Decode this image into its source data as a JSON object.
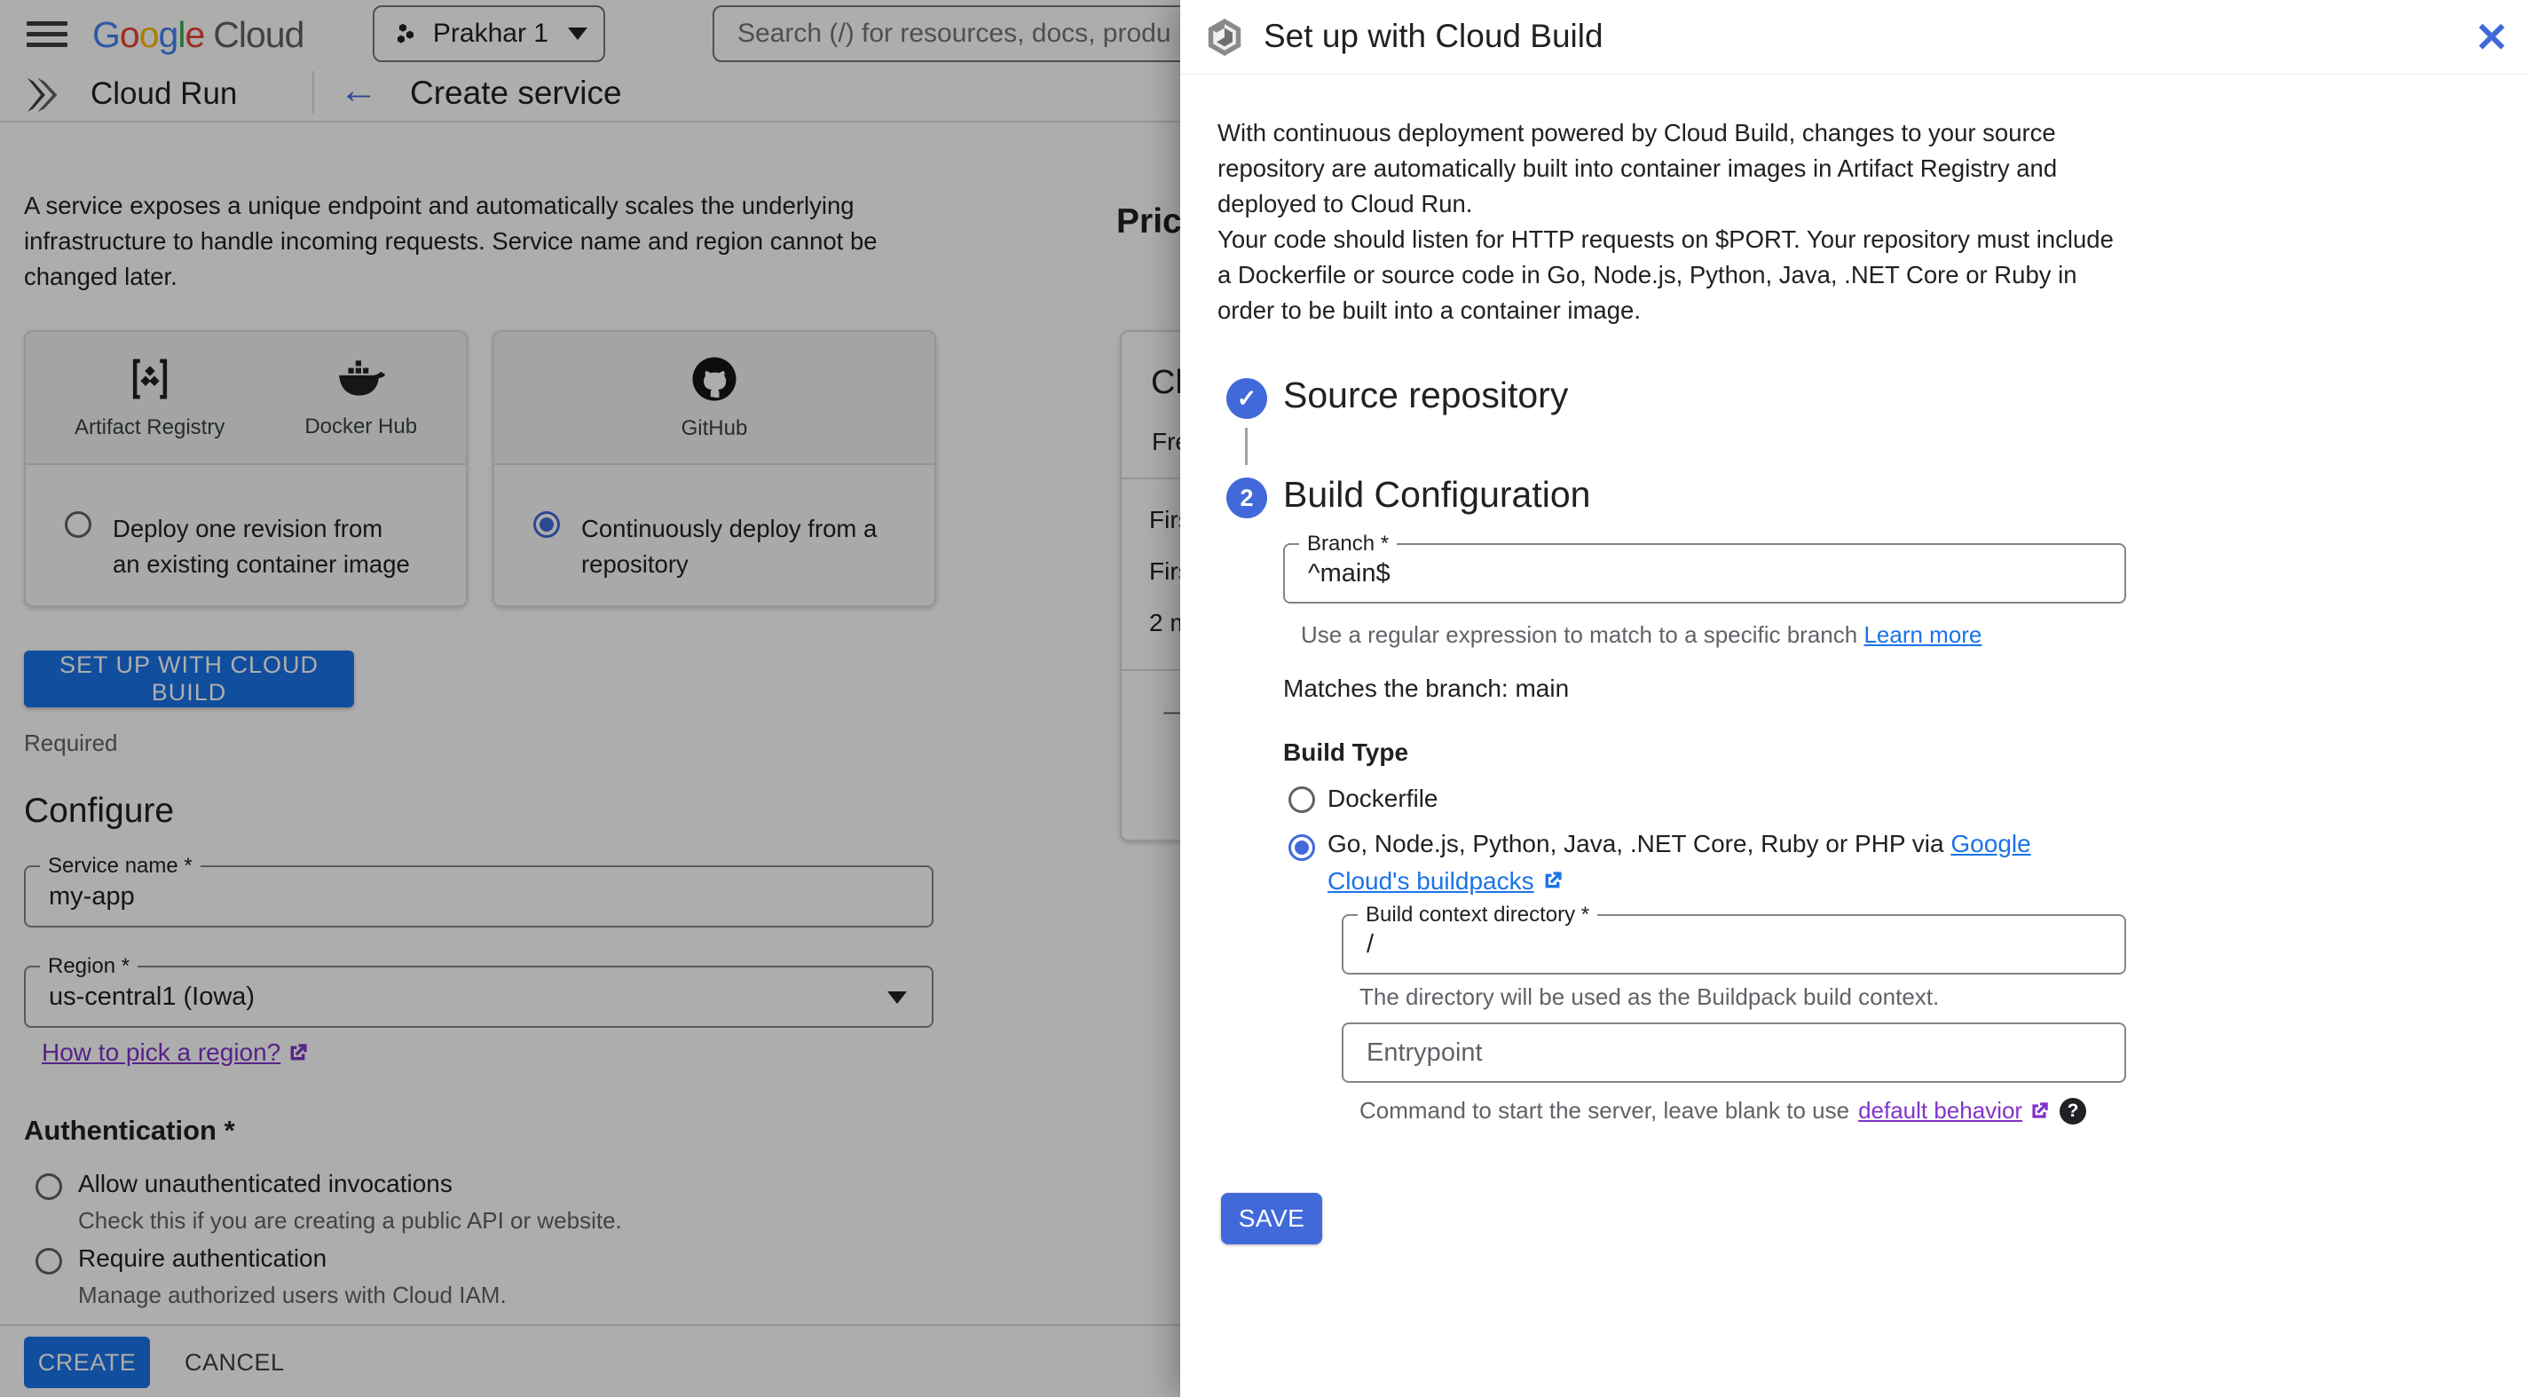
{
  "icons": {
    "back_arrow": "←",
    "close": "✕",
    "check": "✓",
    "step2": "2",
    "arrow_right": "→",
    "help": "?"
  },
  "topbar": {
    "logo_letters": [
      "G",
      "o",
      "o",
      "g",
      "l",
      "e"
    ],
    "logo_cloud": "Cloud",
    "project_selector": "Prakhar 1",
    "search_placeholder": "Search (/) for resources, docs, produ"
  },
  "subheader": {
    "product": "Cloud Run",
    "page_title": "Create service"
  },
  "create_form": {
    "intro": "A service exposes a unique endpoint and automatically scales the underlying infrastructure to handle incoming requests. Service name and region cannot be changed later.",
    "cards": [
      {
        "source1": "Artifact Registry",
        "source2": "Docker Hub",
        "option": "Deploy one revision from an existing container image"
      },
      {
        "source1": "GitHub",
        "option": "Continuously deploy from a repository"
      }
    ],
    "setup_button": "SET UP WITH CLOUD BUILD",
    "required_note": "Required",
    "configure_heading": "Configure",
    "service_name": {
      "label": "Service name *",
      "value": "my-app"
    },
    "region": {
      "label": "Region *",
      "value": "us-central1 (Iowa)"
    },
    "region_link": "How to pick a region?",
    "auth_heading": "Authentication *",
    "auth_option1": {
      "label": "Allow unauthenticated invocations",
      "help": "Check this if you are creating a public API or website."
    },
    "auth_option2": {
      "label": "Require authentication",
      "help": "Manage authorized users with Cloud IAM."
    },
    "create_button": "CREATE",
    "cancel_button": "CANCEL"
  },
  "pricing": {
    "heading_fragment": "Pric",
    "title_fragment": "Cl",
    "subtitle_fragment": "Fre",
    "row1_fragment": "Firs",
    "row2_fragment": "Firs",
    "row3_fragment": "2 m"
  },
  "panel": {
    "title": "Set up with Cloud Build",
    "description_p1": "With continuous deployment powered by Cloud Build, changes to your source repository are automatically built into container images in Artifact Registry and deployed to Cloud Run.",
    "description_p2": "Your code should listen for HTTP requests on $PORT. Your repository must include a Dockerfile or source code in Go, Node.js, Python, Java, .NET Core or Ruby in order to be built into a container image.",
    "step1_title": "Source repository",
    "step2_title": "Build Configuration",
    "branch": {
      "label": "Branch *",
      "value": "^main$",
      "helper": "Use a regular expression to match to a specific branch ",
      "helper_link": "Learn more"
    },
    "matches_text": "Matches the branch: main",
    "build_type_label": "Build Type",
    "build_type_option1": "Dockerfile",
    "build_type_option2_prefix": "Go, Node.js, Python, Java, .NET Core, Ruby or PHP via ",
    "build_type_option2_link": "Google Cloud's buildpacks",
    "context_dir": {
      "label": "Build context directory *",
      "value": "/",
      "helper": "The directory will be used as the Buildpack build context."
    },
    "entrypoint": {
      "placeholder": "Entrypoint",
      "helper_prefix": "Command to start the server, leave blank to use ",
      "helper_link": "default behavior"
    },
    "save_button": "SAVE"
  },
  "colors": {
    "panel_blue": "#4169d9",
    "link_blue": "#1a73e8",
    "visited_purple": "#8133cb",
    "text_primary": "#202124",
    "text_secondary": "#5f6368"
  }
}
